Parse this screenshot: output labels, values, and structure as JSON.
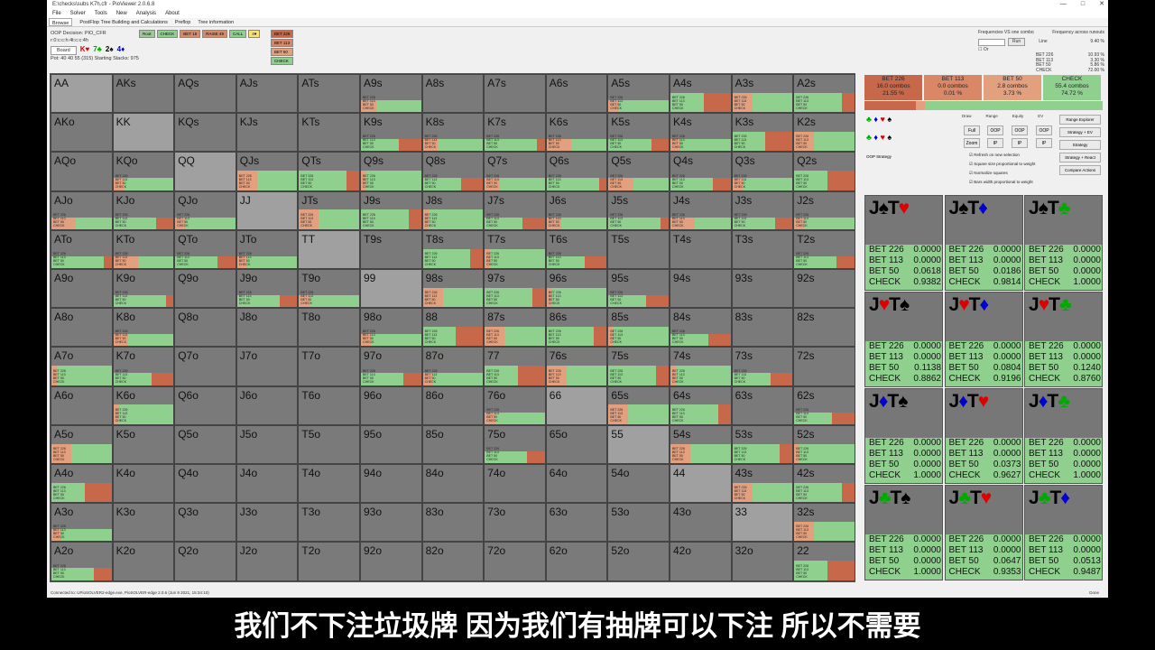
{
  "window": {
    "title": "E:\\checks\\subs K7h.cfr - PioViewer 2.0.6.8",
    "controls": [
      "—",
      "□",
      "✕"
    ]
  },
  "menu": [
    "File",
    "Solver",
    "Tools",
    "New",
    "Analysis",
    "About"
  ],
  "tabs": [
    {
      "label": "Browse",
      "active": true
    },
    {
      "label": "PostFlop Tree Building and Calculations",
      "active": false
    },
    {
      "label": "Preflop",
      "active": false
    },
    {
      "label": "Tree information",
      "active": false
    }
  ],
  "oop": {
    "decision_label": "OOP Decision:",
    "decision_player": "PIO_CFR",
    "file": "r:0:c:c:h:4t:c:c:4h",
    "board_button": "Board",
    "board_cards": [
      {
        "r": "K",
        "s": "♥",
        "c": "#d00"
      },
      {
        "r": "7",
        "s": "♣",
        "c": "#0a0"
      },
      {
        "r": "2",
        "s": "♠",
        "c": "#000"
      },
      {
        "r": "4",
        "s": "♦",
        "c": "#00c"
      }
    ],
    "pot_text": "Pot: 40 40 55 (315) Starting Stacks: 975"
  },
  "path": [
    {
      "label": "Root",
      "color": "#9ec79a"
    },
    {
      "label": "CHECK",
      "color": "#8fd08f"
    },
    {
      "label": "BET 15",
      "color": "#d58a6a"
    },
    {
      "label": "RAISE 49",
      "color": "#d58a6a"
    },
    {
      "label": "CALL",
      "color": "#8fd08f"
    },
    {
      "label": "4♥",
      "color": "#f7e27a"
    }
  ],
  "path_options": [
    {
      "label": "BET 226",
      "color": "#c8684a"
    },
    {
      "label": "BET 113",
      "color": "#d98767"
    },
    {
      "label": "BET 50",
      "color": "#e3a07f"
    },
    {
      "label": "CHECK",
      "color": "#8fd08f"
    }
  ],
  "top_right": {
    "freq_vs_label": "Frequencies VS one combo",
    "freq_runouts_label": "Frequency across runouts",
    "run_button": "Run",
    "or_label": "Or",
    "line_label": "Line",
    "line_value": "9.40 %",
    "freq_rows": [
      {
        "label": "BET 226",
        "value": "10.93 %"
      },
      {
        "label": "BET 113",
        "value": "3.30 %"
      },
      {
        "label": "BET 50",
        "value": "5.86 %"
      },
      {
        "label": "CHECK",
        "value": "72.00 %"
      }
    ]
  },
  "summary": [
    {
      "label": "BET 226",
      "combos": "16.0 combos",
      "pct": "21.55 %",
      "color": "#c8684a"
    },
    {
      "label": "BET 113",
      "combos": "0.0 combos",
      "pct": "0.01 %",
      "color": "#d98767"
    },
    {
      "label": "BET 50",
      "combos": "2.8 combos",
      "pct": "3.73 %",
      "color": "#e3a07f"
    },
    {
      "label": "CHECK",
      "combos": "55.4 combos",
      "pct": "74.72 %",
      "color": "#8fd08f"
    }
  ],
  "legend_fractions": [
    0.2155,
    0.0001,
    0.0373,
    0.7472
  ],
  "right_controls": {
    "headers": [
      "Draw",
      "Range",
      "Equity",
      "EV"
    ],
    "full_button": "Full",
    "oop_buttons": [
      "OOP",
      "OOP",
      "OOP"
    ],
    "zoom_button": "Zoom",
    "ip_buttons": [
      "IP",
      "IP",
      "IP"
    ],
    "strategy_label": "OOP Strategy",
    "side_buttons": [
      "Range Explorer",
      "Strategy + EV",
      "Strategy",
      "Strategy + React",
      "Compare Actions"
    ],
    "checks": [
      "Refresh on new selection",
      "Square size proportional to weight",
      "Normalize squares",
      "Bars width proportional to weight"
    ]
  },
  "grid": {
    "ranks": [
      "A",
      "K",
      "Q",
      "J",
      "T",
      "9",
      "8",
      "7",
      "6",
      "5",
      "4",
      "3",
      "2"
    ],
    "row_labels": [
      "BET 226",
      "BET 113",
      "BET 50",
      "CHECK"
    ],
    "colors": [
      "#c8684a",
      "#d98767",
      "#e3a07f",
      "#8fd08f"
    ],
    "grey": "#7a7a7a",
    "pair_grey": "#a0a0a0",
    "active": [
      [
        0,
        5
      ],
      [
        0,
        9
      ],
      [
        0,
        10
      ],
      [
        0,
        11
      ],
      [
        0,
        12
      ],
      [
        1,
        5
      ],
      [
        1,
        6
      ],
      [
        1,
        7
      ],
      [
        1,
        8
      ],
      [
        1,
        9
      ],
      [
        1,
        10
      ],
      [
        1,
        11
      ],
      [
        1,
        12
      ],
      [
        2,
        1
      ],
      [
        2,
        3
      ],
      [
        2,
        4
      ],
      [
        2,
        5
      ],
      [
        2,
        6
      ],
      [
        2,
        7
      ],
      [
        2,
        8
      ],
      [
        2,
        9
      ],
      [
        2,
        10
      ],
      [
        2,
        11
      ],
      [
        2,
        12
      ],
      [
        3,
        0
      ],
      [
        3,
        1
      ],
      [
        3,
        2
      ],
      [
        3,
        4
      ],
      [
        3,
        5
      ],
      [
        3,
        6
      ],
      [
        3,
        7
      ],
      [
        3,
        8
      ],
      [
        3,
        9
      ],
      [
        3,
        10
      ],
      [
        3,
        11
      ],
      [
        3,
        12
      ],
      [
        4,
        0
      ],
      [
        4,
        1
      ],
      [
        4,
        2
      ],
      [
        4,
        3
      ],
      [
        4,
        6
      ],
      [
        4,
        7
      ],
      [
        4,
        8
      ],
      [
        4,
        12
      ],
      [
        5,
        1
      ],
      [
        5,
        3
      ],
      [
        5,
        4
      ],
      [
        5,
        6
      ],
      [
        5,
        7
      ],
      [
        5,
        8
      ],
      [
        5,
        9
      ],
      [
        6,
        1
      ],
      [
        6,
        5
      ],
      [
        6,
        6
      ],
      [
        6,
        7
      ],
      [
        6,
        8
      ],
      [
        6,
        9
      ],
      [
        6,
        10
      ],
      [
        7,
        0
      ],
      [
        7,
        1
      ],
      [
        7,
        5
      ],
      [
        7,
        6
      ],
      [
        7,
        7
      ],
      [
        7,
        8
      ],
      [
        7,
        9
      ],
      [
        7,
        10
      ],
      [
        7,
        11
      ],
      [
        8,
        1
      ],
      [
        8,
        7
      ],
      [
        8,
        9
      ],
      [
        8,
        10
      ],
      [
        8,
        12
      ],
      [
        9,
        0
      ],
      [
        9,
        7
      ],
      [
        9,
        10
      ],
      [
        9,
        11
      ],
      [
        9,
        12
      ],
      [
        10,
        0
      ],
      [
        10,
        11
      ],
      [
        10,
        12
      ],
      [
        11,
        0
      ],
      [
        11,
        12
      ],
      [
        12,
        0
      ],
      [
        12,
        12
      ]
    ]
  },
  "boards": [
    {
      "cards": [
        {
          "r": "J",
          "s": "♠",
          "c": "#000"
        },
        {
          "r": "T",
          "s": "♥",
          "c": "#d00"
        }
      ],
      "v": [
        "0.0000",
        "0.0000",
        "0.0618",
        "0.9382"
      ]
    },
    {
      "cards": [
        {
          "r": "J",
          "s": "♠",
          "c": "#000"
        },
        {
          "r": "T",
          "s": "♦",
          "c": "#00c"
        }
      ],
      "v": [
        "0.0000",
        "0.0000",
        "0.0186",
        "0.9814"
      ]
    },
    {
      "cards": [
        {
          "r": "J",
          "s": "♠",
          "c": "#000"
        },
        {
          "r": "T",
          "s": "♣",
          "c": "#0a0"
        }
      ],
      "v": [
        "0.0000",
        "0.0000",
        "0.0000",
        "1.0000"
      ]
    },
    {
      "cards": [
        {
          "r": "J",
          "s": "♥",
          "c": "#d00"
        },
        {
          "r": "T",
          "s": "♠",
          "c": "#000"
        }
      ],
      "v": [
        "0.0000",
        "0.0000",
        "0.1138",
        "0.8862"
      ]
    },
    {
      "cards": [
        {
          "r": "J",
          "s": "♥",
          "c": "#d00"
        },
        {
          "r": "T",
          "s": "♦",
          "c": "#00c"
        }
      ],
      "v": [
        "0.0000",
        "0.0000",
        "0.0804",
        "0.9196"
      ]
    },
    {
      "cards": [
        {
          "r": "J",
          "s": "♥",
          "c": "#d00"
        },
        {
          "r": "T",
          "s": "♣",
          "c": "#0a0"
        }
      ],
      "v": [
        "0.0000",
        "0.0000",
        "0.1240",
        "0.8760"
      ]
    },
    {
      "cards": [
        {
          "r": "J",
          "s": "♦",
          "c": "#00c"
        },
        {
          "r": "T",
          "s": "♠",
          "c": "#000"
        }
      ],
      "v": [
        "0.0000",
        "0.0000",
        "0.0000",
        "1.0000"
      ]
    },
    {
      "cards": [
        {
          "r": "J",
          "s": "♦",
          "c": "#00c"
        },
        {
          "r": "T",
          "s": "♥",
          "c": "#d00"
        }
      ],
      "v": [
        "0.0000",
        "0.0000",
        "0.0373",
        "0.9627"
      ]
    },
    {
      "cards": [
        {
          "r": "J",
          "s": "♦",
          "c": "#00c"
        },
        {
          "r": "T",
          "s": "♣",
          "c": "#0a0"
        }
      ],
      "v": [
        "0.0000",
        "0.0000",
        "0.0000",
        "1.0000"
      ]
    },
    {
      "cards": [
        {
          "r": "J",
          "s": "♣",
          "c": "#0a0"
        },
        {
          "r": "T",
          "s": "♠",
          "c": "#000"
        }
      ],
      "v": [
        "0.0000",
        "0.0000",
        "0.0000",
        "1.0000"
      ]
    },
    {
      "cards": [
        {
          "r": "J",
          "s": "♣",
          "c": "#0a0"
        },
        {
          "r": "T",
          "s": "♥",
          "c": "#d00"
        }
      ],
      "v": [
        "0.0000",
        "0.0000",
        "0.0647",
        "0.9353"
      ]
    },
    {
      "cards": [
        {
          "r": "J",
          "s": "♣",
          "c": "#0a0"
        },
        {
          "r": "T",
          "s": "♦",
          "c": "#00c"
        }
      ],
      "v": [
        "0.0000",
        "0.0000",
        "0.0513",
        "0.9487"
      ]
    }
  ],
  "status": {
    "left": "Connected to: UPioSOLVER2-edge.exe, PioSOLVER-edge 2.0.6 (Jun 9 2021, 15:34:10)",
    "right": "Done"
  },
  "subtitle": "我们不下注垃圾牌 因为我们有抽牌可以下注 所以不需要"
}
